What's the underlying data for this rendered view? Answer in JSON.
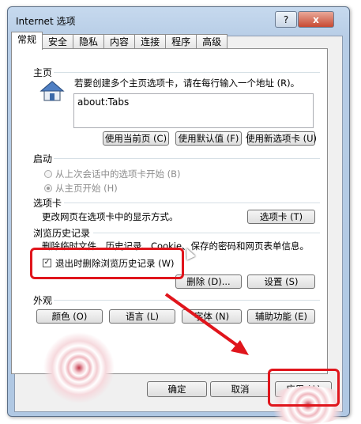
{
  "window": {
    "title": "Internet 选项",
    "help_label": "?",
    "close_label": "x"
  },
  "tabs": [
    "常规",
    "安全",
    "隐私",
    "内容",
    "连接",
    "程序",
    "高级"
  ],
  "homepage": {
    "heading": "主页",
    "instruction": "若要创建多个主页选项卡，请在每行输入一个地址 (R)。",
    "address": "about:Tabs",
    "buttons": [
      "使用当前页 (C)",
      "使用默认值 (F)",
      "使用新选项卡 (U)"
    ]
  },
  "startup": {
    "heading": "启动",
    "options": [
      {
        "label": "从上次会话中的选项卡开始 (B)",
        "selected": false
      },
      {
        "label": "从主页开始 (H)",
        "selected": true
      }
    ]
  },
  "tabs_section": {
    "heading": "选项卡",
    "description": "更改网页在选项卡中的显示方式。",
    "button": "选项卡 (T)"
  },
  "history": {
    "heading": "浏览历史记录",
    "description": "删除临时文件、历史记录、Cookie、保存的密码和网页表单信息。",
    "checkbox_label": "退出时删除浏览历史记录 (W)",
    "checked": true,
    "buttons": [
      "删除 (D)...",
      "设置 (S)"
    ]
  },
  "appearance": {
    "heading": "外观",
    "buttons": [
      "颜色 (O)",
      "语言 (L)",
      "字体 (N)",
      "辅助功能 (E)"
    ]
  },
  "footer": {
    "ok": "确定",
    "cancel": "取消",
    "apply": "应用 (A)"
  },
  "colors": {
    "annotation_red": "#e0151c",
    "title_bar": "#b7cde6",
    "arrow_red": "#e0151c"
  }
}
